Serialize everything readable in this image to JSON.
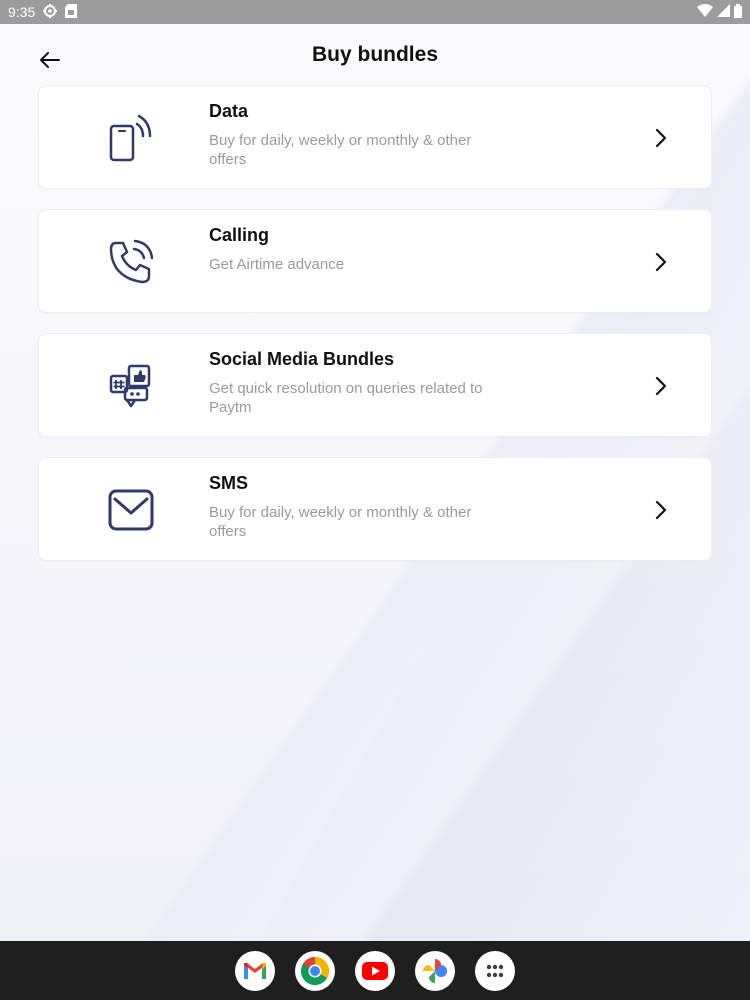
{
  "status_bar": {
    "time": "9:35",
    "left_icons": [
      "settings-icon",
      "sim-card-icon"
    ],
    "right_icons": [
      "wifi-icon",
      "signal-icon",
      "battery-icon"
    ]
  },
  "header": {
    "title": "Buy bundles",
    "back_icon": "arrow-left-icon"
  },
  "cards": [
    {
      "title": "Data",
      "description": "Buy for daily, weekly or monthly & other offers",
      "icon": "phone-signal-icon"
    },
    {
      "title": "Calling",
      "description": "Get Airtime advance",
      "icon": "phone-call-icon"
    },
    {
      "title": "Social Media Bundles",
      "description": "Get quick resolution on queries related to Paytm",
      "icon": "social-media-icon"
    },
    {
      "title": "SMS",
      "description": "Buy for daily, weekly or monthly & other offers",
      "icon": "envelope-icon"
    }
  ],
  "taskbar": {
    "apps": [
      "gmail-icon",
      "chrome-icon",
      "youtube-icon",
      "photos-icon",
      "app-drawer-icon"
    ]
  },
  "colors": {
    "icon_navy": "#2f3a6b",
    "title": "#111111",
    "description": "#9a9a9a",
    "card_bg": "#ffffff",
    "taskbar_bg": "#1f1f1f",
    "status_bar_bg": "#9c9c9c"
  }
}
